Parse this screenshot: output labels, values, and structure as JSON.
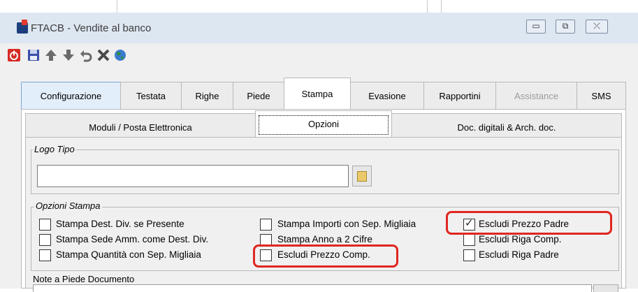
{
  "window": {
    "title": "FTACB - Vendite al banco",
    "controls": {
      "minimize": "▭",
      "restore": "⧉",
      "close": "⤫"
    }
  },
  "toolbar": {
    "icons": [
      "power-icon",
      "save-icon",
      "arrow-up-icon",
      "arrow-down-icon",
      "undo-icon",
      "delete-icon",
      "globe-icon"
    ],
    "colors": {
      "power": "#d62b23",
      "save": "#3b4ea8",
      "arrows": "#6a6a6a",
      "delete": "#4a4a4a",
      "globe": "#2f8f3a"
    }
  },
  "tabs": [
    {
      "label": "Configurazione"
    },
    {
      "label": "Testata"
    },
    {
      "label": "Righe"
    },
    {
      "label": "Piede"
    },
    {
      "label": "Stampa",
      "active": true
    },
    {
      "label": "Evasione"
    },
    {
      "label": "Rapportini"
    },
    {
      "label": "Assistance",
      "disabled": true
    },
    {
      "label": "SMS"
    }
  ],
  "subtabs": [
    {
      "label": "Moduli / Posta Elettronica"
    },
    {
      "label": "Opzioni",
      "active": true
    },
    {
      "label": "Doc. digitali & Arch. doc."
    }
  ],
  "logo": {
    "legend": "Logo Tipo",
    "value": ""
  },
  "options": {
    "legend": "Opzioni Stampa",
    "items": [
      {
        "label": "Stampa Dest. Div. se Presente",
        "checked": false
      },
      {
        "label": "Stampa Sede Amm. come Dest. Div.",
        "checked": false
      },
      {
        "label": "Stampa Quantità con Sep. Migliaia",
        "checked": false
      },
      {
        "label": "Stampa Importi con Sep. Migliaia",
        "checked": false
      },
      {
        "label": "Stampa Anno a 2 Cifre",
        "checked": false
      },
      {
        "label": "Escludi Prezzo Comp.",
        "checked": false,
        "highlighted": true
      },
      {
        "label": "Escludi Prezzo Padre",
        "checked": true,
        "highlighted": true
      },
      {
        "label": "Escludi Riga Comp.",
        "checked": false
      },
      {
        "label": "Escludi Riga Padre",
        "checked": false
      }
    ],
    "check_mark": "✓",
    "highlight_color": "#e0261f"
  },
  "notes": {
    "label": "Note a Piede Documento",
    "value": ""
  }
}
